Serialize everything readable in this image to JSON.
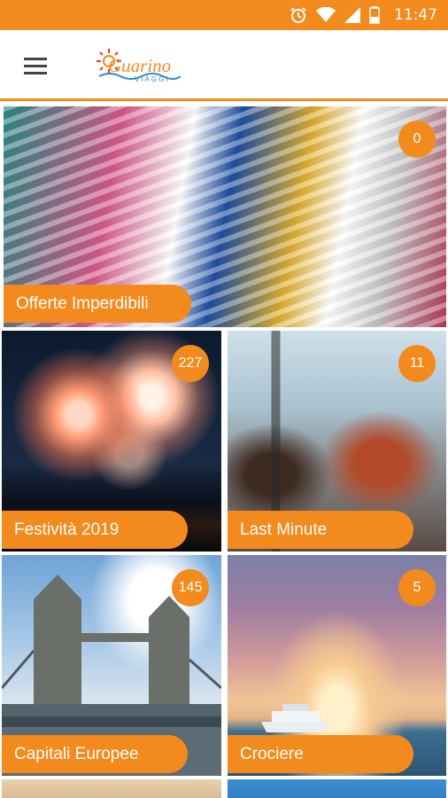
{
  "status_bar": {
    "time": "11:47",
    "icons": [
      "alarm-icon",
      "wifi-icon",
      "signal-icon",
      "battery-icon"
    ]
  },
  "app_bar": {
    "logo_text": "Guarino",
    "logo_subtitle": "VIAGGI",
    "menu_icon": "hamburger-menu-icon"
  },
  "colors": {
    "accent": "#f28a1e",
    "text_on_accent": "#ffffff"
  },
  "tiles": [
    {
      "label": "Offerte Imperdibili",
      "count": "0"
    },
    {
      "label": "Festività 2019",
      "count": "227"
    },
    {
      "label": "Last Minute",
      "count": "11"
    },
    {
      "label": "Capitali Europee",
      "count": "145"
    },
    {
      "label": "Crociere",
      "count": "5"
    }
  ]
}
